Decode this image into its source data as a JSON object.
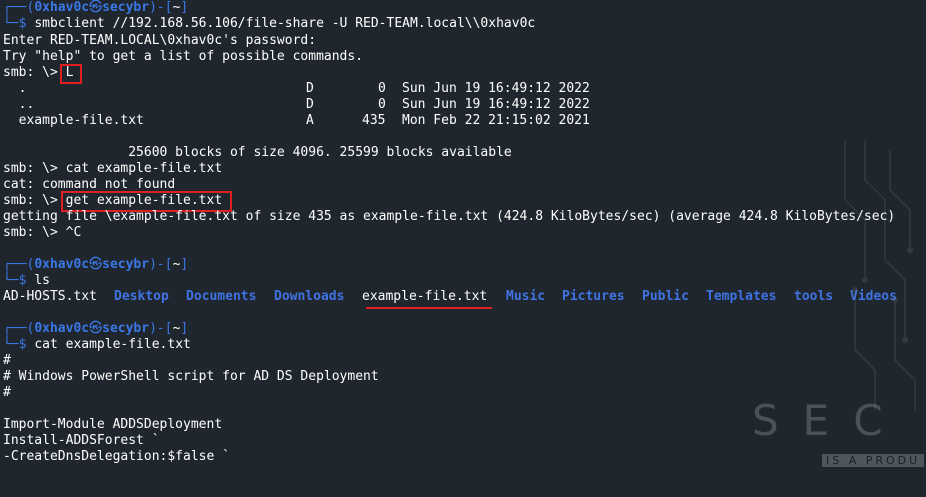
{
  "colors": {
    "background": "#20262d",
    "accent_blue": "#3a78e8",
    "highlight_red": "#e02020"
  },
  "prompt": {
    "user": "0xhav0c",
    "at_symbol": "㉿",
    "host": "secybr",
    "dir": "~"
  },
  "lines": {
    "l1_cmd": "smbclient //192.168.56.106/file-share -U RED-TEAM.local\\\\0xhav0c",
    "l2": "Enter RED-TEAM.LOCAL\\0xhav0c's password:",
    "l3": "Try \"help\" to get a list of possible commands.",
    "l4_prefix": "smb: \\> ",
    "l4_cmd": "L",
    "dir1_name": "  .",
    "dir1_type": "D",
    "dir1_size": "0",
    "dir1_date": "Sun Jun 19 16:49:12 2022",
    "dir2_name": "  ..",
    "dir2_type": "D",
    "dir2_size": "0",
    "dir2_date": "Sun Jun 19 16:49:12 2022",
    "file1_name": "  example-file.txt",
    "file1_type": "A",
    "file1_size": "435",
    "file1_date": "Mon Feb 22 21:15:02 2021",
    "blocks": "                25600 blocks of size 4096. 25599 blocks available",
    "l_cat": "smb: \\> cat example-file.txt",
    "l_catnf": "cat: command not found",
    "l_get_prefix": "smb: \\> ",
    "l_get_cmd": "get example-file.txt",
    "l_getting": "getting file \\example-file.txt of size 435 as example-file.txt (424.8 KiloBytes/sec) (average 424.8 KiloBytes/sec)",
    "l_ctrlc": "smb: \\> ^C",
    "ls_cmd": "ls",
    "cat2_cmd": "cat example-file.txt",
    "f1": "#",
    "f2": "# Windows PowerShell script for AD DS Deployment",
    "f3": "#",
    "f4": "Import-Module ADDSDeployment",
    "f5": "Install-ADDSForest `",
    "f6": "-CreateDnsDelegation:$false `"
  },
  "ls_output": {
    "file_adhosts": "AD-HOSTS.txt",
    "desktop": "Desktop",
    "documents": "Documents",
    "downloads": "Downloads",
    "example": "example-file.txt",
    "music": "Music",
    "pictures": "Pictures",
    "public": "Public",
    "templates": "Templates",
    "tools": "tools",
    "videos": "Videos"
  },
  "watermark": {
    "text": "SEC",
    "sub": "IS A PRODU"
  }
}
